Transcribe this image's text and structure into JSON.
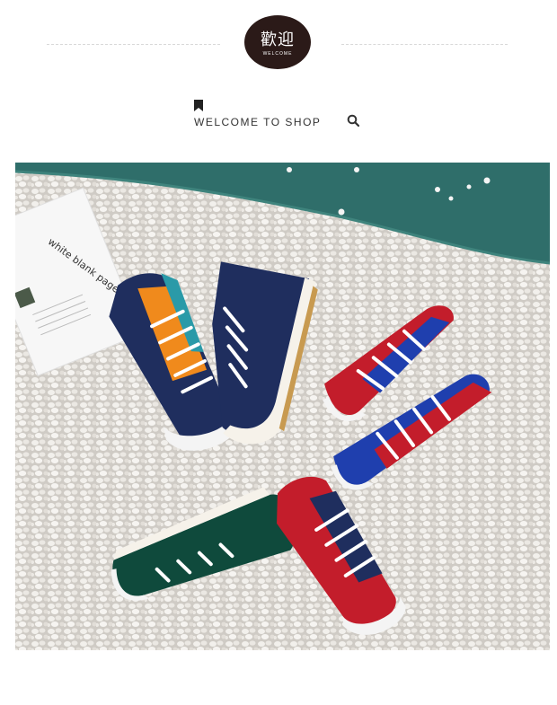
{
  "header": {
    "logo_text_cn": "歡迎",
    "logo_text_en": "WELCOME",
    "welcome_label": "WELCOME TO SHOP",
    "bookmark_icon": "bookmark-icon",
    "search_icon": "search-icon",
    "logo_color": "#2b1a18"
  },
  "photo": {
    "paper_title": "white blank page",
    "colors": {
      "pebbles": "#e6e3de",
      "water": "#2f6e6a",
      "navy": "#1f2e5e",
      "orange": "#f08a1c",
      "teal": "#2a9aa8",
      "red": "#c31d2b",
      "blue": "#1f3fae",
      "green": "#0f4a3c"
    }
  }
}
